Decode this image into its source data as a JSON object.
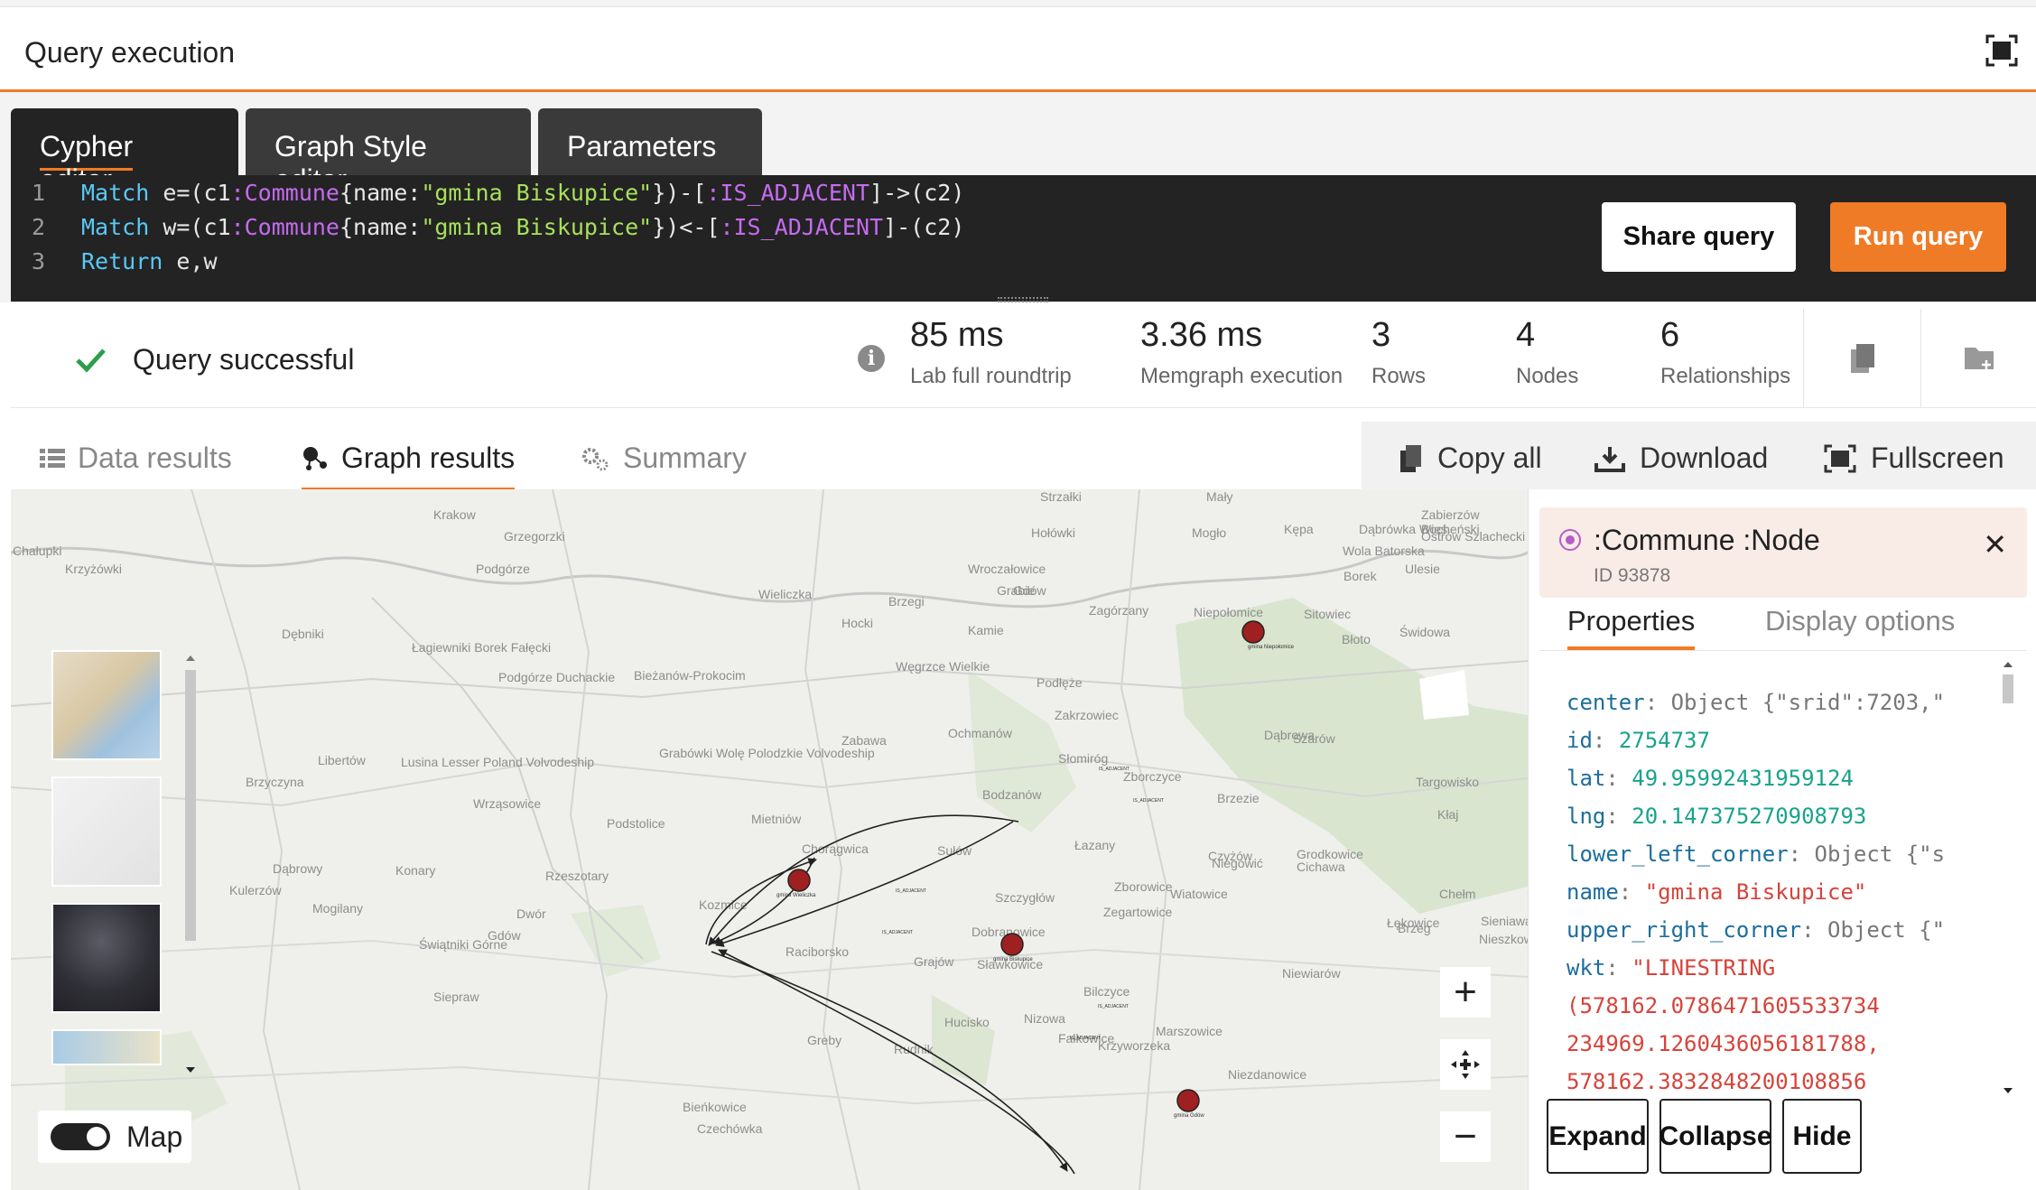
{
  "header": {
    "title": "Query execution",
    "fullscreen_icon": "fullscreen-icon"
  },
  "tabs": [
    {
      "label": "Cypher editor",
      "active": true
    },
    {
      "label": "Graph Style editor",
      "active": false
    },
    {
      "label": "Parameters",
      "active": false
    }
  ],
  "editor": {
    "lines": [
      {
        "num": "1",
        "kw": "Match",
        "a": " e=(c1",
        "lbl1": ":Commune",
        "b": "{name:",
        "str": "\"gmina Biskupice\"",
        "c": "})-[",
        "lbl2": ":IS_ADJACENT",
        "d": "]->(c2)"
      },
      {
        "num": "2",
        "kw": "Match",
        "a": " w=(c1",
        "lbl1": ":Commune",
        "b": "{name:",
        "str": "\"gmina Biskupice\"",
        "c": "})<-[",
        "lbl2": ":IS_ADJACENT",
        "d": "]-(c2)"
      },
      {
        "num": "3",
        "kw": "Return",
        "a": " e,w"
      }
    ],
    "share_label": "Share query",
    "run_label": "Run query"
  },
  "status": {
    "text": "Query successful",
    "color": "#2e9e4a",
    "stats": [
      {
        "value": "85 ms",
        "label": "Lab full roundtrip"
      },
      {
        "value": "3.36 ms",
        "label": "Memgraph execution"
      },
      {
        "value": "3",
        "label": "Rows"
      },
      {
        "value": "4",
        "label": "Nodes"
      },
      {
        "value": "6",
        "label": "Relationships"
      }
    ]
  },
  "result_tabs": [
    {
      "label": "Data results",
      "icon": "table-icon",
      "active": false
    },
    {
      "label": "Graph results",
      "icon": "graph-icon",
      "active": true
    },
    {
      "label": "Summary",
      "icon": "gears-icon",
      "active": false
    }
  ],
  "result_actions": {
    "copy_label": "Copy all",
    "download_label": "Download",
    "fullscreen_label": "Fullscreen"
  },
  "map": {
    "places": [
      "Krakow",
      "Grzegorzki",
      "Podgórze",
      "Chałupki",
      "Krzyżówki",
      "Wieliczka",
      "Strzałki",
      "Dębniki",
      "Łagiewniki Borek Fałęcki",
      "Podgórze Duchackie",
      "Bieżanów-Prokocim",
      "Grabówki Wolę Polodzkie Volvodeship",
      "Libertów",
      "Lusina Lesser Poland Volvodeship",
      "Brzyczyna",
      "Wrząsowice",
      "Podstolice",
      "Mietniów",
      "Chorągwica",
      "Sułów",
      "Mały",
      "Mogło",
      "Kępa",
      "Wola Batorska",
      "Dąbrówka Wieś",
      "Zabierzów Bocheński",
      "Ostrów Szlachecki",
      "Borek",
      "Ulesie",
      "Gdów",
      "Niepołomice",
      "Sitowiec",
      "Świdowa",
      "Błoto",
      "Hołówki",
      "Wroczałowice",
      "Zagórzany",
      "Grabie",
      "Kamie",
      "Węgrzce Wielkie",
      "Brzegi",
      "Hocki",
      "Podłęże",
      "Zakrzowiec",
      "Ochmanów",
      "Zabawa",
      "Bodzanów",
      "Słomiróg",
      "Dąbrowa",
      "Szarów",
      "Cichawa",
      "Brzezie",
      "Targowisko",
      "Kłaj",
      "Zborczyce",
      "Łazany",
      "Czyżów",
      "Grodkowice",
      "Zborowice",
      "Szczygłów",
      "Chełm",
      "Łękowice",
      "Niegowić",
      "Wiatowice",
      "Sieniawa",
      "Brzeg",
      "Nieszkowice",
      "Dobranowice",
      "Grajów",
      "Raciborsko",
      "Sławkowice",
      "Bilczyce",
      "Niewiarów",
      "Kozmice",
      "Konary",
      "Dąbrowy",
      "Mogilany",
      "Dwór",
      "Kulerzów",
      "Rzeszotary",
      "Gdów",
      "Świątniki Górne",
      "Hucisko",
      "Nizowa",
      "Marszowice",
      "Krzyworzeka",
      "Fałkowice",
      "Niezdanowice",
      "Rudnik",
      "Greby",
      "Siepraw",
      "Bieńkowice",
      "Czechówka",
      "Zegartowice"
    ],
    "toggle_label": "Map",
    "toggle_on": true
  },
  "graph": {
    "nodes": [
      {
        "label": "gmina Niepołomice"
      },
      {
        "label": "gmina Wieliczka"
      },
      {
        "label": "gmina Biskupice"
      },
      {
        "label": "gmina Gdów"
      }
    ],
    "edge_label": "IS_ADJACENT",
    "node_color": "#9e2020"
  },
  "inspector": {
    "title": ":Commune :Node",
    "id": "ID 93878",
    "tab_properties": "Properties",
    "tab_display": "Display options",
    "properties": [
      {
        "key": "center",
        "value": "Object {\"srid\":7203,\"",
        "type": "obj"
      },
      {
        "key": "id",
        "value": "2754737",
        "type": "num"
      },
      {
        "key": "lat",
        "value": "49.95992431959124",
        "type": "num"
      },
      {
        "key": "lng",
        "value": "20.147375270908793",
        "type": "num"
      },
      {
        "key": "lower_left_corner",
        "value": "Object {\"s",
        "type": "obj"
      },
      {
        "key": "name",
        "value": "\"gmina Biskupice\"",
        "type": "str"
      },
      {
        "key": "upper_right_corner",
        "value": "Object {\"",
        "type": "obj"
      },
      {
        "key": "wkt",
        "value": "\"LINESTRING",
        "type": "str"
      }
    ],
    "wkt_cont": [
      "(578162.0786471605533734",
      "234969.1260436056181788,",
      "578162.3832848200108856"
    ],
    "expand_label": "Expand",
    "collapse_label": "Collapse",
    "hide_label": "Hide"
  }
}
